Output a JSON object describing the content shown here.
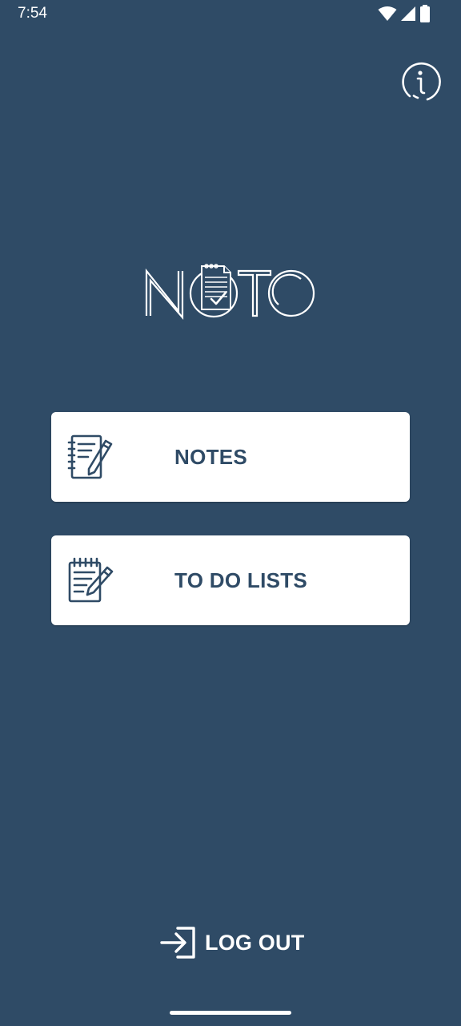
{
  "status_bar": {
    "time": "7:54",
    "icons": [
      "wifi-icon",
      "signal-icon",
      "battery-icon"
    ]
  },
  "header": {
    "info_icon": "info-icon"
  },
  "logo": {
    "text": "NOTO"
  },
  "menu": {
    "items": [
      {
        "label": "NOTES",
        "icon": "notebook-pencil-icon"
      },
      {
        "label": "TO DO LISTS",
        "icon": "notepad-pencil-icon"
      }
    ]
  },
  "footer": {
    "logout_label": "LOG OUT",
    "logout_icon": "login-arrow-icon"
  },
  "colors": {
    "background": "#2f4b66",
    "card": "#ffffff",
    "accent_text": "#2f4b66"
  }
}
